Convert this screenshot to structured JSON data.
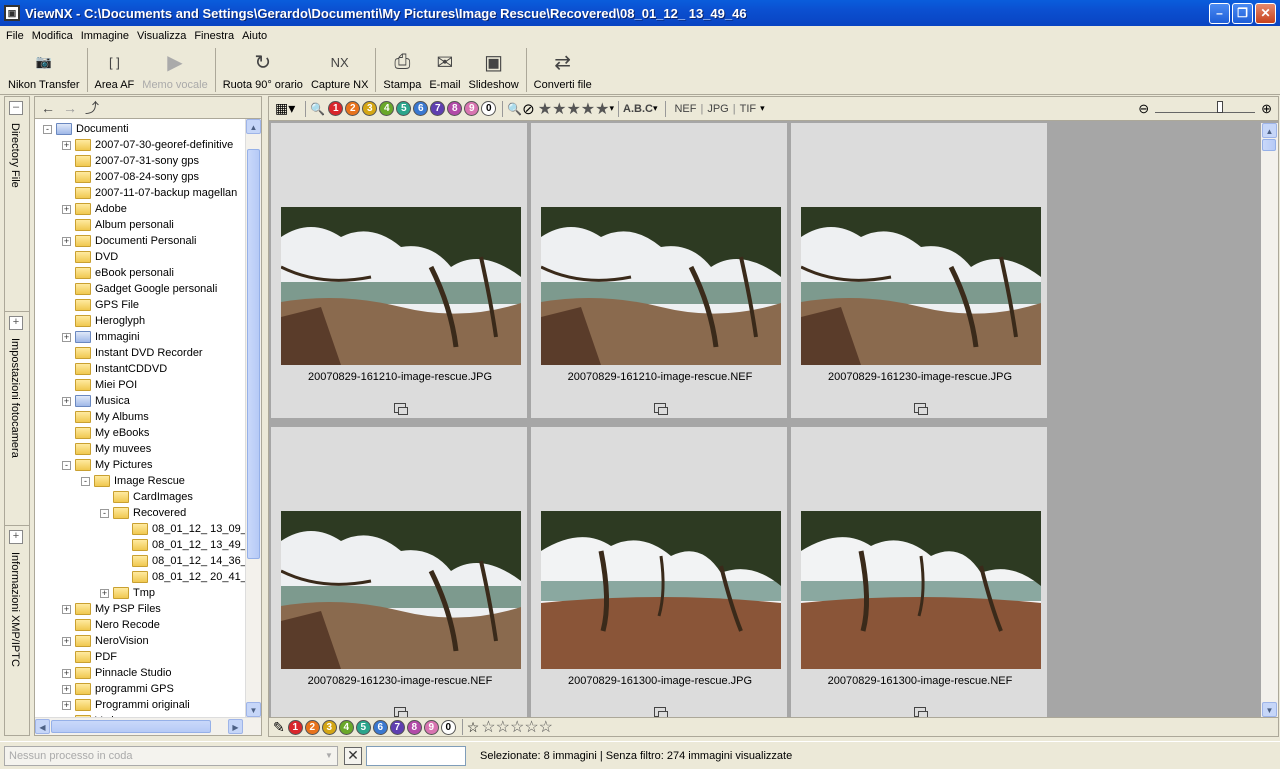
{
  "window": {
    "title": "ViewNX - C:\\Documents and Settings\\Gerardo\\Documenti\\My Pictures\\Image Rescue\\Recovered\\08_01_12_ 13_49_46"
  },
  "menu": [
    "File",
    "Modifica",
    "Immagine",
    "Visualizza",
    "Finestra",
    "Aiuto"
  ],
  "toolbar": [
    {
      "label": "Nikon Transfer",
      "icon": "camera-transfer-icon",
      "glyph": "📷",
      "enabled": true
    },
    {
      "label": "Area AF",
      "icon": "af-area-icon",
      "glyph": "[ ]",
      "enabled": true
    },
    {
      "label": "Memo vocale",
      "icon": "voice-memo-icon",
      "glyph": "▶",
      "enabled": false
    },
    {
      "label": "Ruota 90° orario",
      "icon": "rotate-cw-icon",
      "glyph": "↻",
      "enabled": true
    },
    {
      "label": "Capture NX",
      "icon": "capture-nx-icon",
      "glyph": "NX",
      "enabled": true
    },
    {
      "label": "Stampa",
      "icon": "print-icon",
      "glyph": "⎙",
      "enabled": true
    },
    {
      "label": "E-mail",
      "icon": "email-icon",
      "glyph": "✉",
      "enabled": true
    },
    {
      "label": "Slideshow",
      "icon": "slideshow-icon",
      "glyph": "▣",
      "enabled": true
    },
    {
      "label": "Converti file",
      "icon": "convert-file-icon",
      "glyph": "⇄",
      "enabled": true
    }
  ],
  "side_tabs": [
    "Directory File",
    "Impostazioni fotocamera",
    "Informazioni XMP/IPTC"
  ],
  "tree": [
    {
      "label": "Documenti",
      "level": 0,
      "exp": "-",
      "special": true
    },
    {
      "label": "2007-07-30-georef-definitive",
      "level": 1,
      "exp": "+"
    },
    {
      "label": "2007-07-31-sony gps",
      "level": 1,
      "exp": ""
    },
    {
      "label": "2007-08-24-sony gps",
      "level": 1,
      "exp": ""
    },
    {
      "label": "2007-11-07-backup magellan",
      "level": 1,
      "exp": ""
    },
    {
      "label": "Adobe",
      "level": 1,
      "exp": "+"
    },
    {
      "label": "Album personali",
      "level": 1,
      "exp": ""
    },
    {
      "label": "Documenti Personali",
      "level": 1,
      "exp": "+"
    },
    {
      "label": "DVD",
      "level": 1,
      "exp": ""
    },
    {
      "label": "eBook personali",
      "level": 1,
      "exp": ""
    },
    {
      "label": "Gadget Google personali",
      "level": 1,
      "exp": ""
    },
    {
      "label": "GPS File",
      "level": 1,
      "exp": ""
    },
    {
      "label": "Heroglyph",
      "level": 1,
      "exp": ""
    },
    {
      "label": "Immagini",
      "level": 1,
      "exp": "+",
      "special": true
    },
    {
      "label": "Instant DVD Recorder",
      "level": 1,
      "exp": ""
    },
    {
      "label": "InstantCDDVD",
      "level": 1,
      "exp": ""
    },
    {
      "label": "Miei POI",
      "level": 1,
      "exp": ""
    },
    {
      "label": "Musica",
      "level": 1,
      "exp": "+",
      "special": true
    },
    {
      "label": "My Albums",
      "level": 1,
      "exp": ""
    },
    {
      "label": "My eBooks",
      "level": 1,
      "exp": ""
    },
    {
      "label": "My muvees",
      "level": 1,
      "exp": ""
    },
    {
      "label": "My Pictures",
      "level": 1,
      "exp": "-"
    },
    {
      "label": "Image Rescue",
      "level": 2,
      "exp": "-"
    },
    {
      "label": "CardImages",
      "level": 3,
      "exp": ""
    },
    {
      "label": "Recovered",
      "level": 3,
      "exp": "-"
    },
    {
      "label": "08_01_12_ 13_09_",
      "level": 4,
      "exp": ""
    },
    {
      "label": "08_01_12_ 13_49_",
      "level": 4,
      "exp": "",
      "selected": true
    },
    {
      "label": "08_01_12_ 14_36_",
      "level": 4,
      "exp": ""
    },
    {
      "label": "08_01_12_ 20_41_",
      "level": 4,
      "exp": ""
    },
    {
      "label": "Tmp",
      "level": 3,
      "exp": "+"
    },
    {
      "label": "My PSP Files",
      "level": 1,
      "exp": "+"
    },
    {
      "label": "Nero Recode",
      "level": 1,
      "exp": ""
    },
    {
      "label": "NeroVision",
      "level": 1,
      "exp": "+"
    },
    {
      "label": "PDF",
      "level": 1,
      "exp": ""
    },
    {
      "label": "Pinnacle Studio",
      "level": 1,
      "exp": "+"
    },
    {
      "label": "programmi GPS",
      "level": 1,
      "exp": "+"
    },
    {
      "label": "Programmi originali",
      "level": 1,
      "exp": "+"
    },
    {
      "label": "Vario",
      "level": 1,
      "exp": "+"
    }
  ],
  "filter": {
    "labels": [
      {
        "n": "1",
        "color": "#d9262c"
      },
      {
        "n": "2",
        "color": "#e8731c"
      },
      {
        "n": "3",
        "color": "#d4a614"
      },
      {
        "n": "4",
        "color": "#6aa82a"
      },
      {
        "n": "5",
        "color": "#2ba58c"
      },
      {
        "n": "6",
        "color": "#3a78d0"
      },
      {
        "n": "7",
        "color": "#5e3fb0"
      },
      {
        "n": "8",
        "color": "#b24aa8"
      },
      {
        "n": "9",
        "color": "#d874b0"
      },
      {
        "n": "0",
        "color": "#ffffff"
      }
    ],
    "sort_label": "A.B.C",
    "formats": [
      "NEF",
      "JPG",
      "TIF"
    ]
  },
  "thumbnails": [
    {
      "filename": "20070829-161210-image-rescue.JPG",
      "variant": "a"
    },
    {
      "filename": "20070829-161210-image-rescue.NEF",
      "variant": "a"
    },
    {
      "filename": "20070829-161230-image-rescue.JPG",
      "variant": "a"
    },
    {
      "filename": "20070829-161230-image-rescue.NEF",
      "variant": "a"
    },
    {
      "filename": "20070829-161300-image-rescue.JPG",
      "variant": "b"
    },
    {
      "filename": "20070829-161300-image-rescue.NEF",
      "variant": "b"
    }
  ],
  "status": {
    "queue_placeholder": "Nessun processo in coda",
    "text": "Selezionate: 8 immagini | Senza filtro: 274 immagini visualizzate"
  }
}
